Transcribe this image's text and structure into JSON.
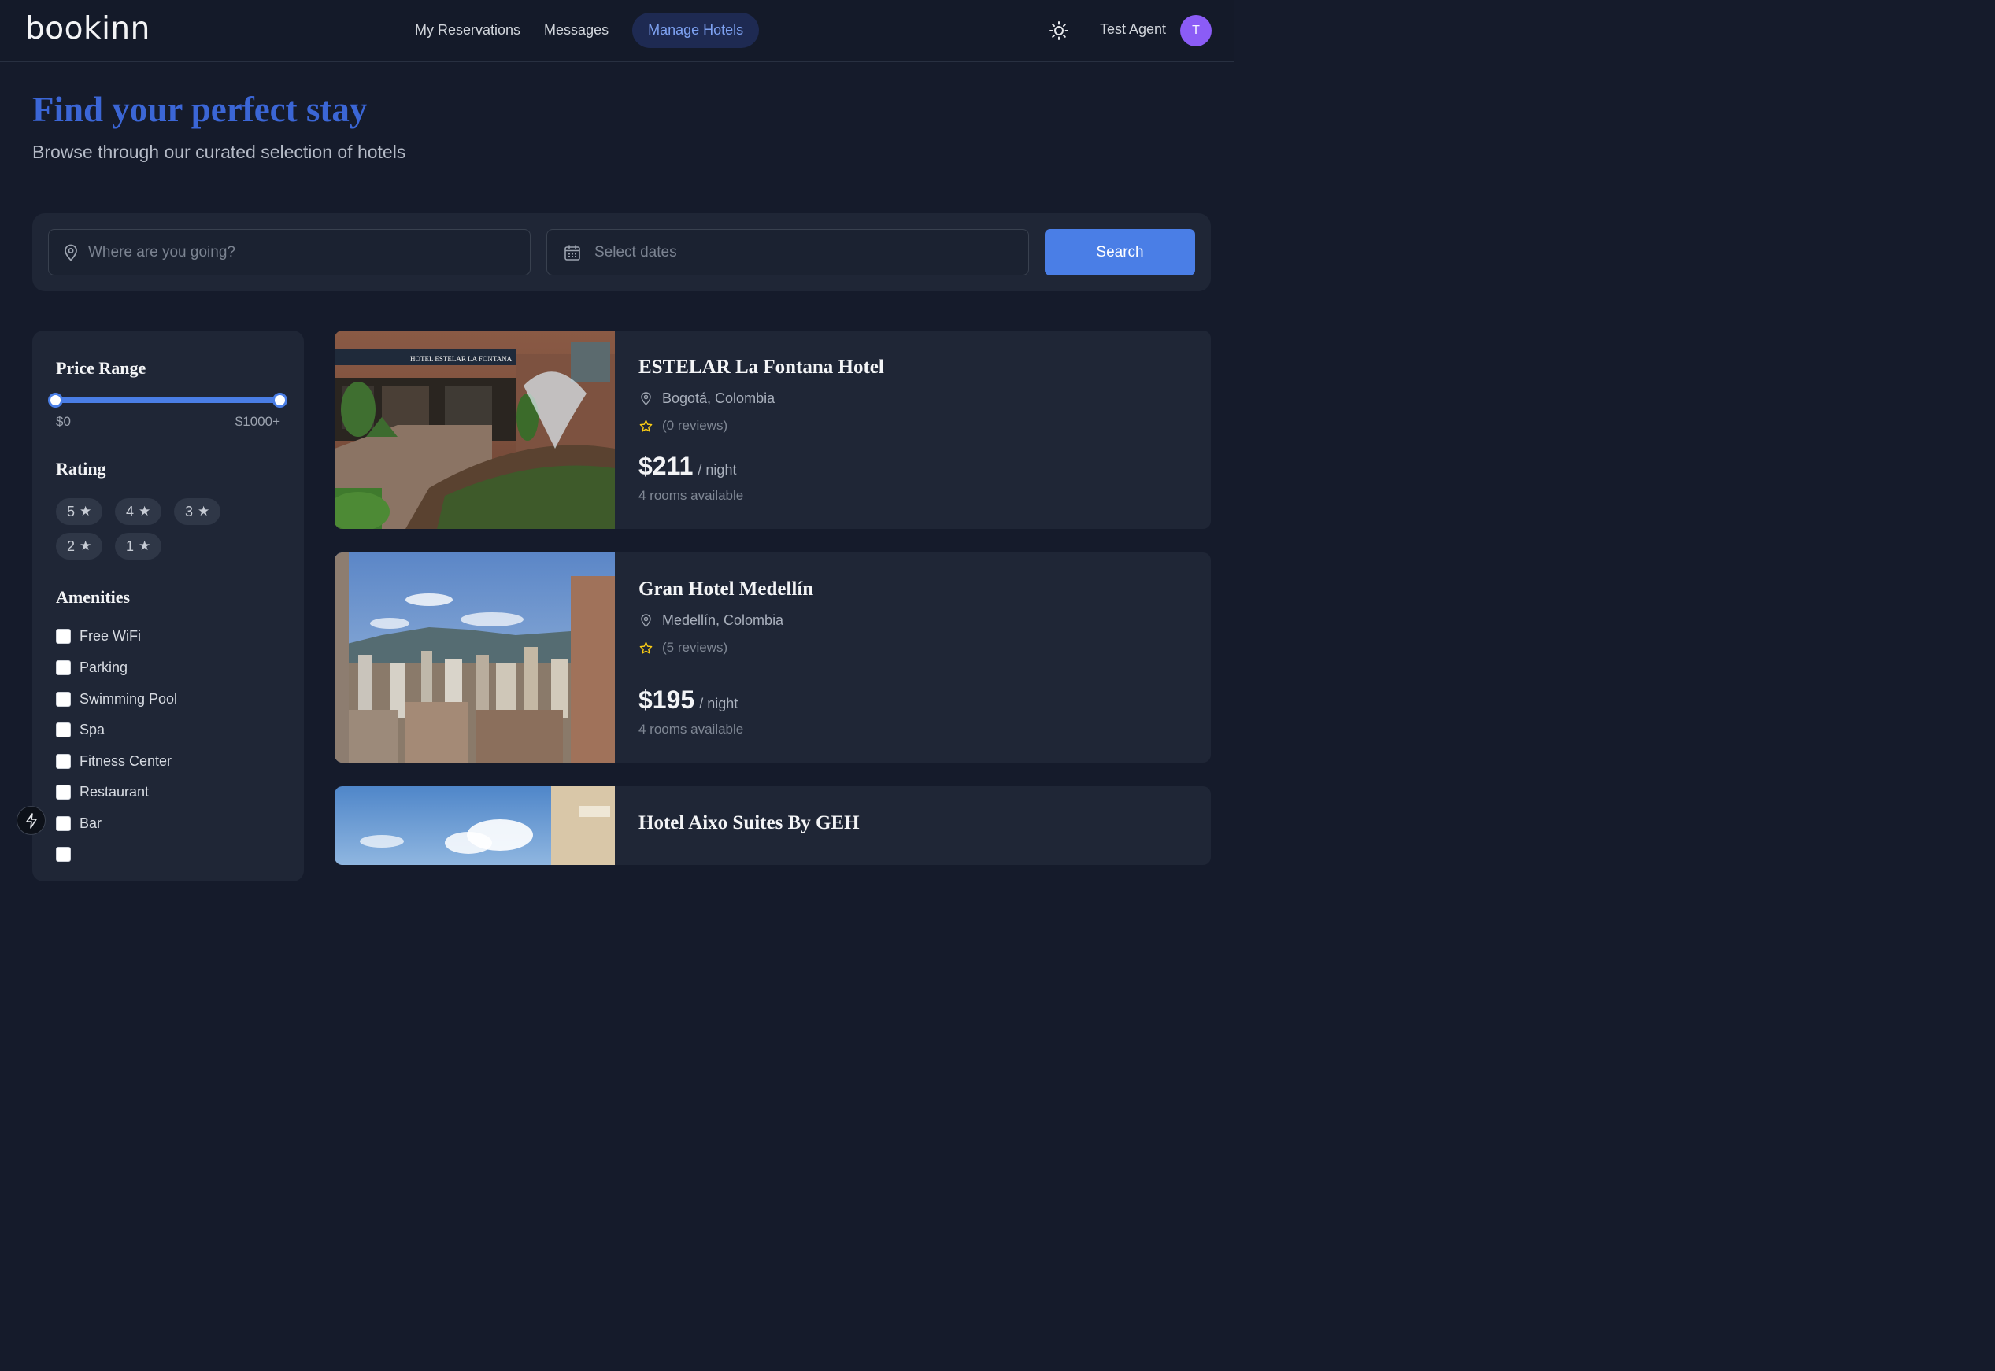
{
  "header": {
    "logo": "bookinn",
    "nav": [
      {
        "label": "My Reservations"
      },
      {
        "label": "Messages"
      },
      {
        "label": "Manage Hotels",
        "active": true
      }
    ],
    "theme_icon": "sun-icon",
    "user_name": "Test Agent",
    "avatar_initial": "T"
  },
  "hero": {
    "title": "Find your perfect stay",
    "subtitle": "Browse through our curated selection of hotels"
  },
  "search": {
    "destination_placeholder": "Where are you going?",
    "dates_placeholder": "Select dates",
    "button_label": "Search"
  },
  "filters": {
    "price": {
      "heading": "Price Range",
      "min_label": "$0",
      "max_label": "$1000+",
      "selected_min_fraction": 0,
      "selected_max_fraction": 1
    },
    "rating": {
      "heading": "Rating",
      "options": [
        "5",
        "4",
        "3",
        "2",
        "1"
      ]
    },
    "amenities": {
      "heading": "Amenities",
      "items": [
        {
          "label": "Free WiFi",
          "checked": false
        },
        {
          "label": "Parking",
          "checked": false
        },
        {
          "label": "Swimming Pool",
          "checked": false
        },
        {
          "label": "Spa",
          "checked": false
        },
        {
          "label": "Fitness Center",
          "checked": false
        },
        {
          "label": "Restaurant",
          "checked": false
        },
        {
          "label": "Bar",
          "checked": false
        }
      ]
    }
  },
  "hotels": [
    {
      "name": "ESTELAR La Fontana Hotel",
      "location": "Bogotá, Colombia",
      "reviews": "(0 reviews)",
      "price": "$211",
      "unit": "/ night",
      "rooms": "4 rooms available",
      "sign_text": "HOTEL ESTELAR LA FONTANA"
    },
    {
      "name": "Gran Hotel Medellín",
      "location": "Medellín, Colombia",
      "reviews": "(5 reviews)",
      "price": "$195",
      "unit": "/ night",
      "rooms": "4 rooms available"
    },
    {
      "name": "Hotel Aixo Suites By GEH"
    }
  ],
  "colors": {
    "background": "#151b2b",
    "card": "#1f2636",
    "accent": "#4a7ee6",
    "title_blue": "#3b66d6",
    "avatar": "#8b5cf6",
    "star": "#facc15"
  }
}
